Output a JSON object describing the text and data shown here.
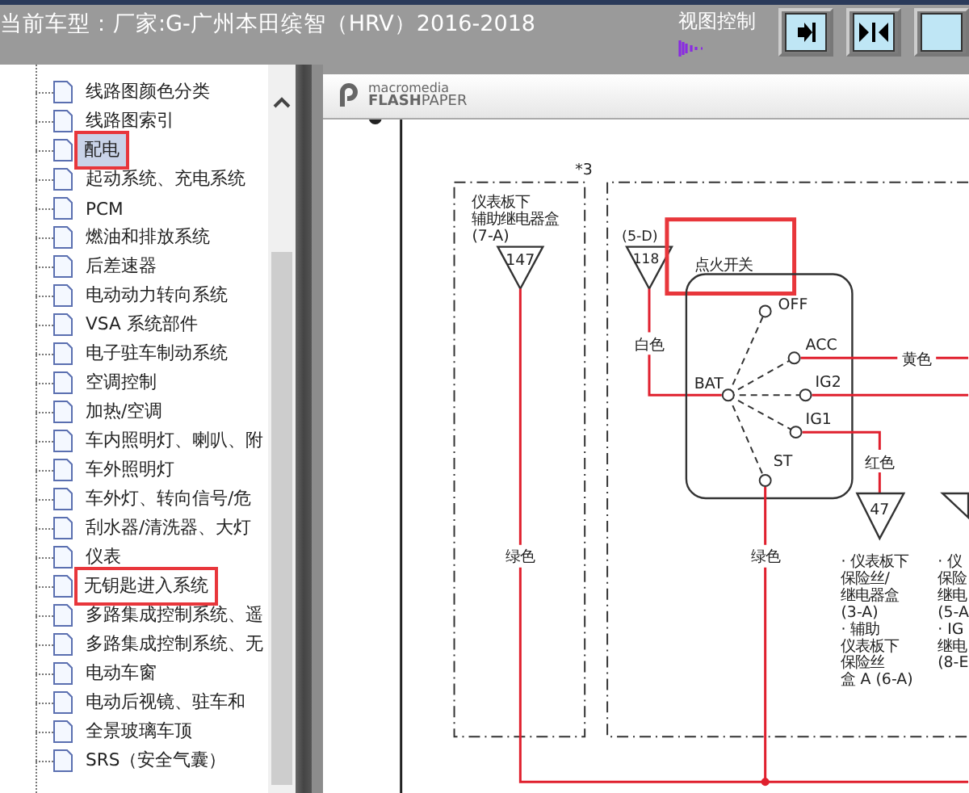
{
  "top_bar": {
    "title": "当前车型：厂家:G-广州本田缤智（HRV）2016-2018",
    "view_control_label": "视图控制",
    "buttons": [
      {
        "kind": "arrow-to-bar"
      },
      {
        "kind": "arrows-inward"
      },
      {
        "kind": "blank"
      }
    ]
  },
  "tree": {
    "items": [
      {
        "label": "线路图颜色分类",
        "selected": false,
        "annotated": false
      },
      {
        "label": "线路图索引",
        "selected": false,
        "annotated": false
      },
      {
        "label": "配电",
        "selected": true,
        "annotated": true
      },
      {
        "label": "起动系统、充电系统",
        "selected": false,
        "annotated": false
      },
      {
        "label": "PCM",
        "selected": false,
        "annotated": false
      },
      {
        "label": "燃油和排放系统",
        "selected": false,
        "annotated": false
      },
      {
        "label": "后差速器",
        "selected": false,
        "annotated": false
      },
      {
        "label": "电动动力转向系统",
        "selected": false,
        "annotated": false
      },
      {
        "label": "VSA 系统部件",
        "selected": false,
        "annotated": false
      },
      {
        "label": "电子驻车制动系统",
        "selected": false,
        "annotated": false
      },
      {
        "label": "空调控制",
        "selected": false,
        "annotated": false
      },
      {
        "label": "加热/空调",
        "selected": false,
        "annotated": false
      },
      {
        "label": "车内照明灯、喇叭、附",
        "selected": false,
        "annotated": false
      },
      {
        "label": "车外照明灯",
        "selected": false,
        "annotated": false
      },
      {
        "label": "车外灯、转向信号/危",
        "selected": false,
        "annotated": false
      },
      {
        "label": "刮水器/清洗器、大灯",
        "selected": false,
        "annotated": false
      },
      {
        "label": "仪表",
        "selected": false,
        "annotated": false
      },
      {
        "label": "无钥匙进入系统",
        "selected": false,
        "annotated": true
      },
      {
        "label": "多路集成控制系统、遥",
        "selected": false,
        "annotated": false
      },
      {
        "label": "多路集成控制系统、无",
        "selected": false,
        "annotated": false
      },
      {
        "label": "电动车窗",
        "selected": false,
        "annotated": false
      },
      {
        "label": "电动后视镜、驻车和",
        "selected": false,
        "annotated": false
      },
      {
        "label": "全景玻璃车顶",
        "selected": false,
        "annotated": false
      },
      {
        "label": "SRS（安全气囊）",
        "selected": false,
        "annotated": false
      }
    ]
  },
  "viewer": {
    "logo_top": "macromedia",
    "logo_bottom_bold": "FLASH",
    "logo_bottom": "PAPER"
  },
  "diagram": {
    "note": "*3",
    "relay_box": {
      "lines": [
        "仪表板下",
        "辅助继电器盒",
        "(7-A)"
      ],
      "terminal": "147",
      "wire": "绿色"
    },
    "source": {
      "ref": "(5-D)",
      "terminal": "118",
      "wire": "白色"
    },
    "switch": {
      "title": "点火开关",
      "annotated": true,
      "common": "BAT",
      "positions": [
        "OFF",
        "ACC",
        "IG2",
        "IG1",
        "ST"
      ]
    },
    "acc_wire": "黄色",
    "ig1_wire": "红色",
    "st_wire": "绿色",
    "fuse": {
      "terminal": "47",
      "lines": [
        "· 仪表板下",
        "保险丝/",
        "继电器盒",
        "(3-A)",
        "· 辅助",
        "仪表板下",
        "保险丝",
        "盒 A (6-A)"
      ]
    },
    "cut_column": {
      "lines": [
        "· 仪",
        "保险",
        "继电",
        "(5-A",
        "· IG",
        "继电",
        "(8-E"
      ]
    }
  }
}
